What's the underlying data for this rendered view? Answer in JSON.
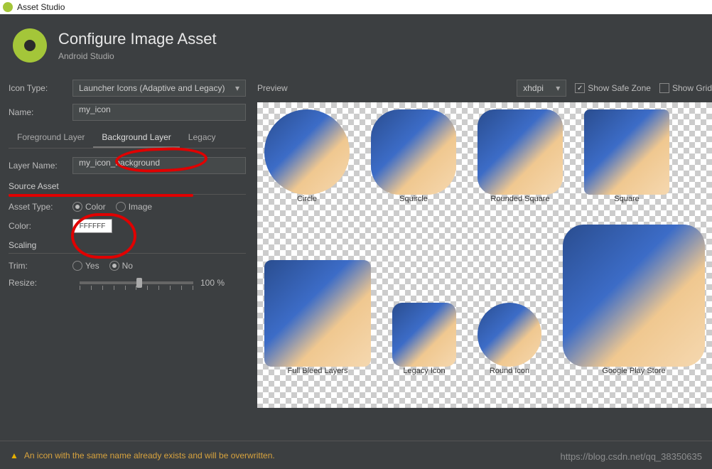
{
  "window": {
    "title": "Asset Studio"
  },
  "header": {
    "title": "Configure Image Asset",
    "subtitle": "Android Studio"
  },
  "form": {
    "icon_type_label": "Icon Type:",
    "icon_type_value": "Launcher Icons (Adaptive and Legacy)",
    "name_label": "Name:",
    "name_value": "my_icon",
    "tabs": {
      "fg": "Foreground Layer",
      "bg": "Background Layer",
      "legacy": "Legacy"
    },
    "layer_name_label": "Layer Name:",
    "layer_name_value": "my_icon_background",
    "source_asset": "Source Asset",
    "asset_type_label": "Asset Type:",
    "asset_type_color": "Color",
    "asset_type_image": "Image",
    "color_label": "Color:",
    "color_value": "FFFFFF",
    "scaling": "Scaling",
    "trim_label": "Trim:",
    "trim_yes": "Yes",
    "trim_no": "No",
    "resize_label": "Resize:",
    "resize_value": "100 %"
  },
  "preview": {
    "label": "Preview",
    "density": "xhdpi",
    "safe_zone": "Show Safe Zone",
    "show_grid": "Show Grid",
    "items": {
      "circle": "Circle",
      "squircle": "Squircle",
      "rounded": "Rounded Square",
      "square": "Square",
      "fbl": "Full Bleed Layers",
      "legacy": "Legacy Icon",
      "round": "Round Icon",
      "play": "Google Play Store"
    }
  },
  "footer": {
    "warning": "An icon with the same name already exists and will be overwritten."
  },
  "watermark": "https://blog.csdn.net/qq_38350635"
}
